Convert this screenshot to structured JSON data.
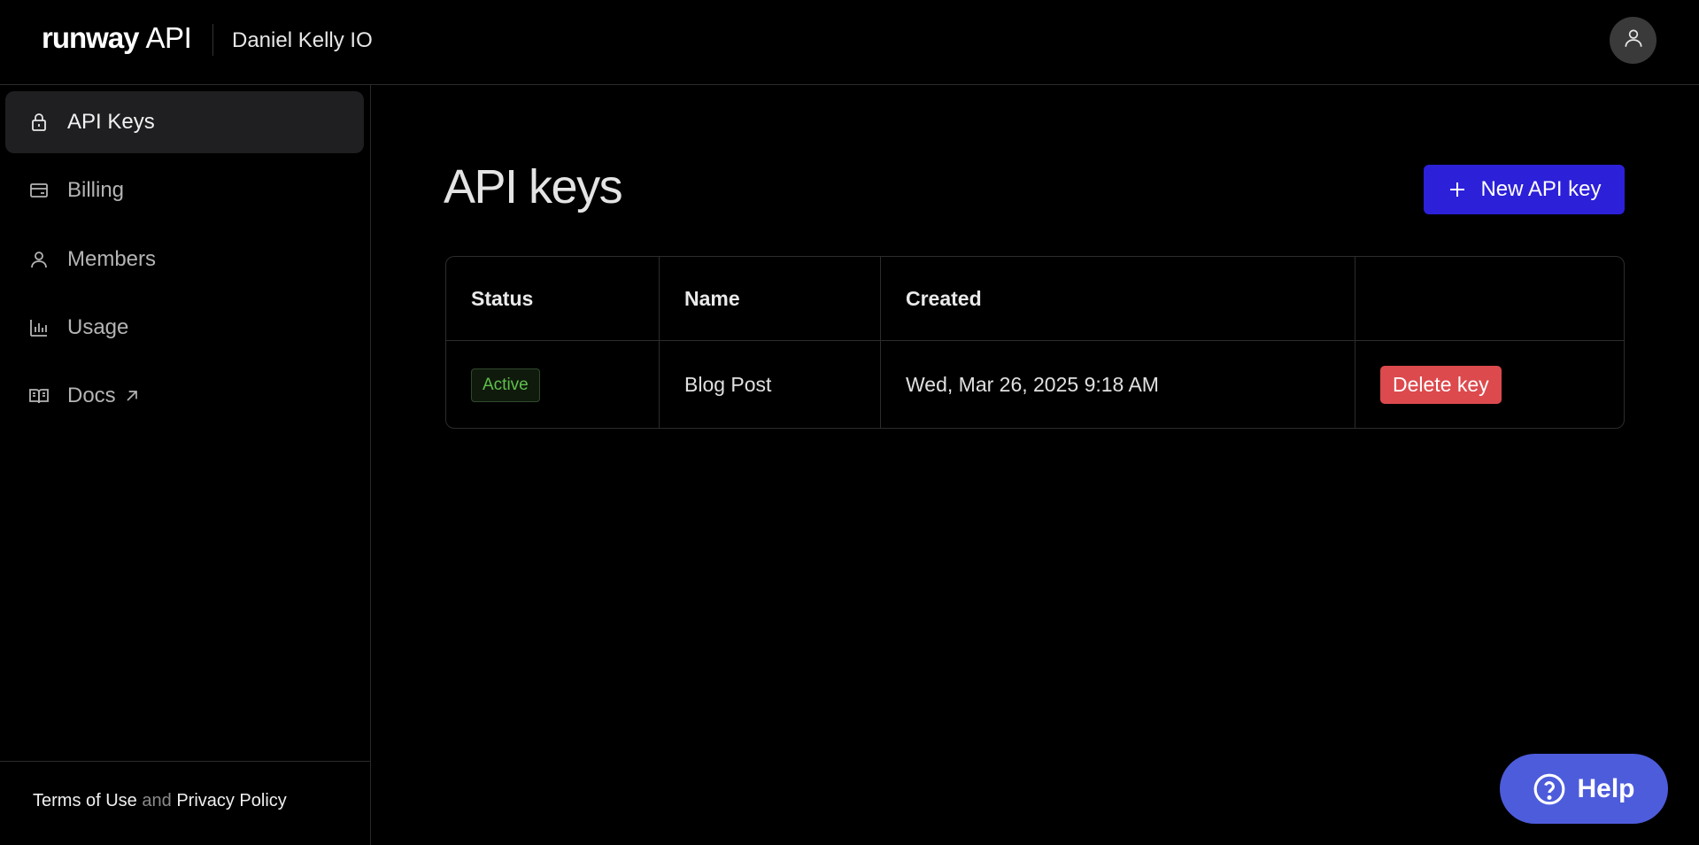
{
  "header": {
    "brand_name": "runway",
    "brand_suffix": "API",
    "org_name": "Daniel Kelly IO",
    "avatar_icon": "user-icon"
  },
  "sidebar": {
    "items": [
      {
        "label": "API Keys",
        "icon": "lock-icon",
        "active": true
      },
      {
        "label": "Billing",
        "icon": "wallet-icon",
        "active": false
      },
      {
        "label": "Members",
        "icon": "user-icon",
        "active": false
      },
      {
        "label": "Usage",
        "icon": "bar-chart-icon",
        "active": false
      },
      {
        "label": "Docs",
        "icon": "book-icon",
        "active": false,
        "external": true
      }
    ],
    "footer": {
      "terms_label": "Terms of Use",
      "and_text": "and",
      "privacy_label": "Privacy Policy"
    }
  },
  "main": {
    "title": "API keys",
    "new_key_label": "New API key",
    "table": {
      "columns": [
        "Status",
        "Name",
        "Created",
        ""
      ],
      "rows": [
        {
          "status": "Active",
          "name": "Blog Post",
          "created": "Wed, Mar 26, 2025 9:18 AM",
          "action_label": "Delete key"
        }
      ]
    }
  },
  "help": {
    "label": "Help"
  },
  "colors": {
    "accent": "#2c20d9",
    "danger": "#dc4a4d",
    "success": "#5fbf4a",
    "help": "#4d5cdb"
  }
}
